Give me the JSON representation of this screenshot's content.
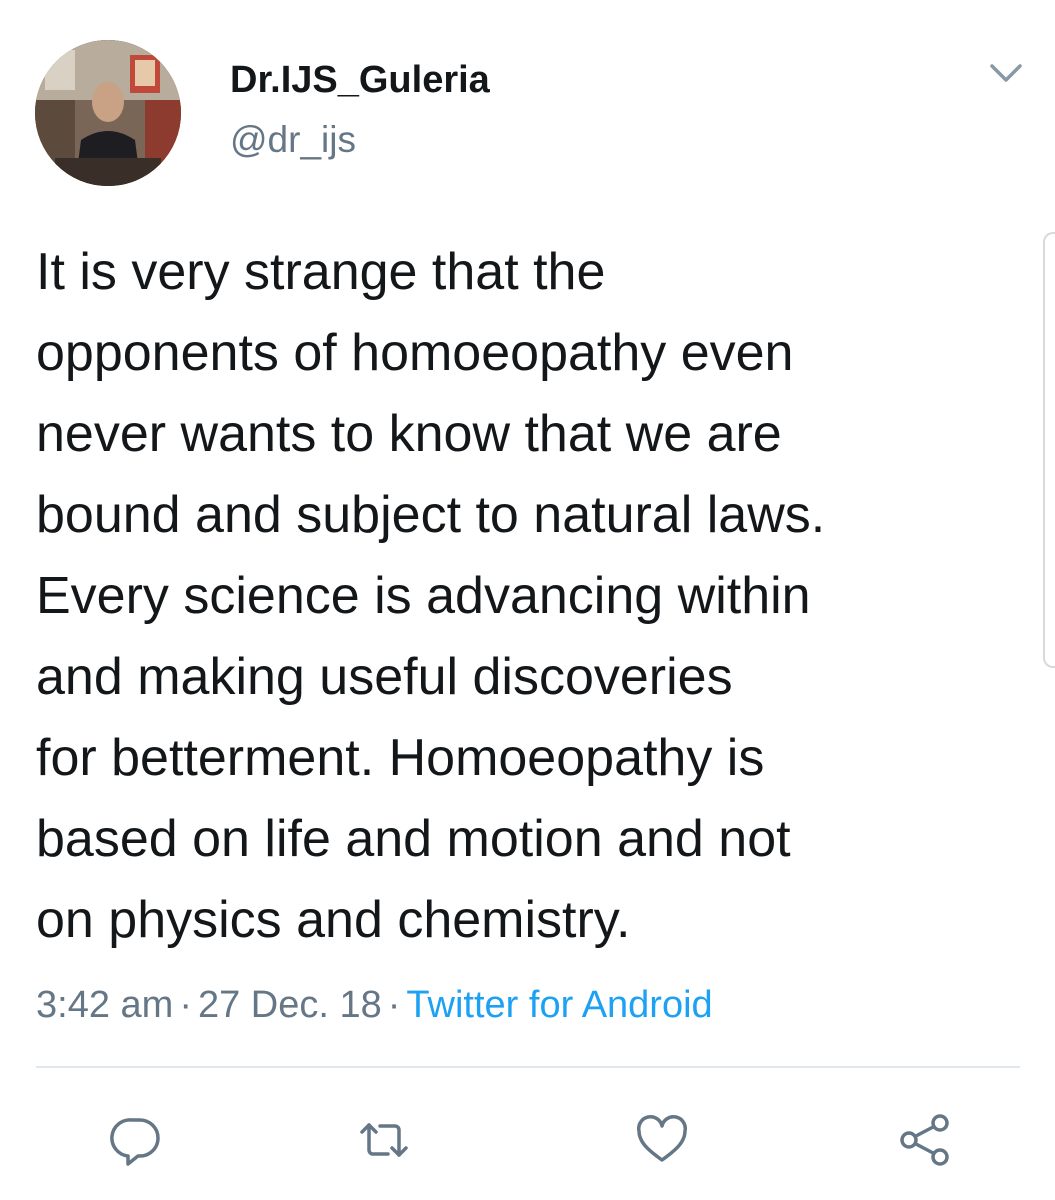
{
  "author": {
    "display_name": "Dr.IJS_Guleria",
    "handle": "@dr_ijs",
    "avatar_icon": "avatar-photo"
  },
  "tweet": {
    "lines": [
      "It is very strange that the",
      "opponents of homoeopathy even",
      "never wants to know that we are",
      "bound and subject to natural laws.",
      "Every science is advancing within",
      "and making useful discoveries",
      "for betterment. Homoeopathy is",
      "based on life and motion and not",
      "on physics and chemistry."
    ],
    "time": "3:42 am",
    "date": "27 Dec. 18",
    "separator": "·",
    "source": "Twitter for Android"
  },
  "actions": [
    {
      "name": "reply",
      "icon": "reply-icon"
    },
    {
      "name": "retweet",
      "icon": "retweet-icon"
    },
    {
      "name": "like",
      "icon": "heart-icon"
    },
    {
      "name": "share",
      "icon": "share-icon"
    }
  ],
  "colors": {
    "text": "#14171a",
    "secondary": "#657786",
    "link": "#1da1f2",
    "divider": "#e1e8ed"
  }
}
